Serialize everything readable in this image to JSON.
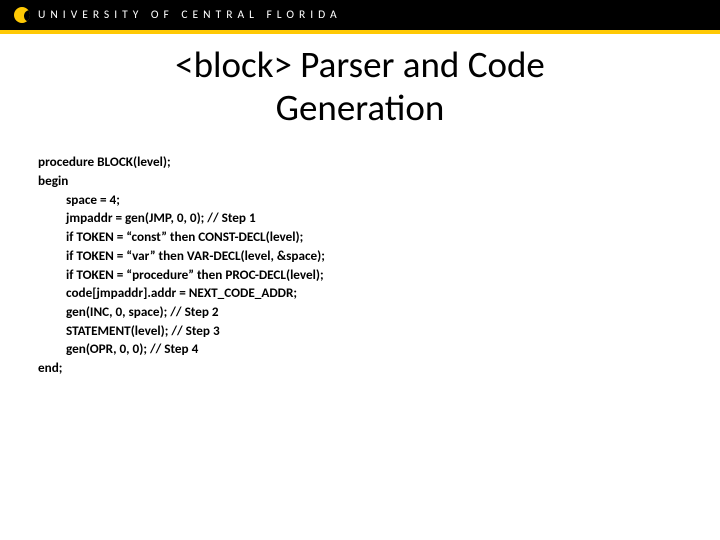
{
  "header": {
    "university": "UNIVERSITY OF CENTRAL FLORIDA"
  },
  "title": {
    "line1": "<block> Parser and Code",
    "line2": "Generation"
  },
  "code": {
    "l1": "procedure BLOCK(level);",
    "l2": "begin",
    "l3": "space = 4;",
    "l4": "jmpaddr = gen(JMP, 0, 0);  // Step 1",
    "l5": "if TOKEN = “const” then CONST-DECL(level);",
    "l6": "if TOKEN = “var” then VAR-DECL(level, &space);",
    "l7": "if TOKEN = “procedure” then  PROC-DECL(level);",
    "l8": "code[jmpaddr].addr = NEXT_CODE_ADDR;",
    "l9": "gen(INC, 0, space); // Step 2",
    "l10": "STATEMENT(level); // Step 3",
    "l11": "gen(OPR, 0, 0); // Step 4",
    "l12": "end;"
  }
}
